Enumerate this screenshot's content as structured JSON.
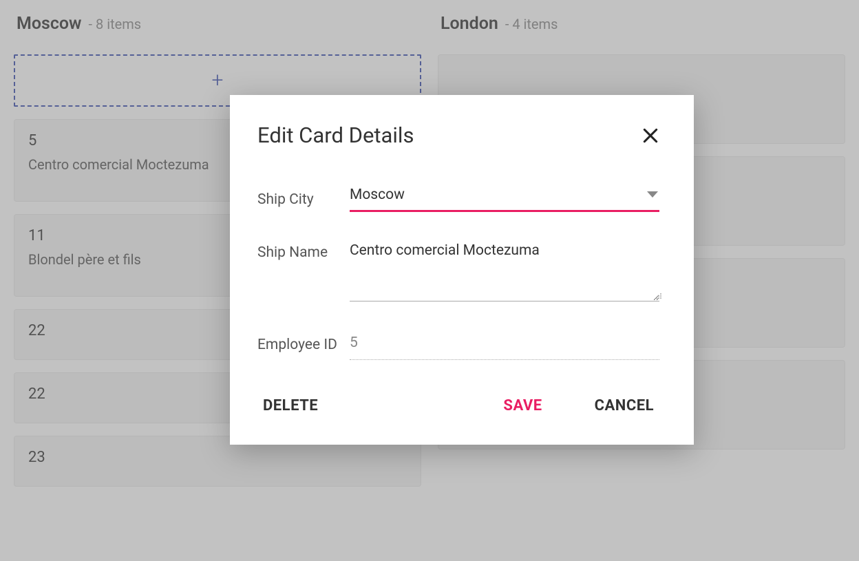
{
  "board": {
    "columns": [
      {
        "title": "Moscow",
        "count_label": "- 8 items",
        "has_add": true,
        "cards": [
          {
            "id": "5",
            "name": "Centro comercial Moctezuma",
            "show_name": true
          },
          {
            "id": "11",
            "name": "Blondel père et fils",
            "show_name": true
          },
          {
            "id": "22",
            "name": "",
            "show_name": false
          },
          {
            "id": "22",
            "name": "",
            "show_name": false
          },
          {
            "id": "23",
            "name": "",
            "show_name": false
          }
        ]
      },
      {
        "title": "London",
        "count_label": "- 4 items",
        "has_add": false,
        "cards": [
          {
            "id": "",
            "name": "",
            "show_name": false
          },
          {
            "id": "",
            "name": "",
            "show_name": false
          },
          {
            "id": "",
            "name": "",
            "show_name": false
          },
          {
            "id": "",
            "name": "",
            "show_name": false
          }
        ]
      }
    ]
  },
  "dialog": {
    "title": "Edit Card Details",
    "fields": {
      "ship_city": {
        "label": "Ship City",
        "value": "Moscow"
      },
      "ship_name": {
        "label": "Ship Name",
        "value": "Centro comercial Moctezuma"
      },
      "employee_id": {
        "label": "Employee ID",
        "value": "5"
      }
    },
    "actions": {
      "delete": "DELETE",
      "save": "SAVE",
      "cancel": "CANCEL"
    }
  },
  "icons": {
    "plus": "+"
  }
}
